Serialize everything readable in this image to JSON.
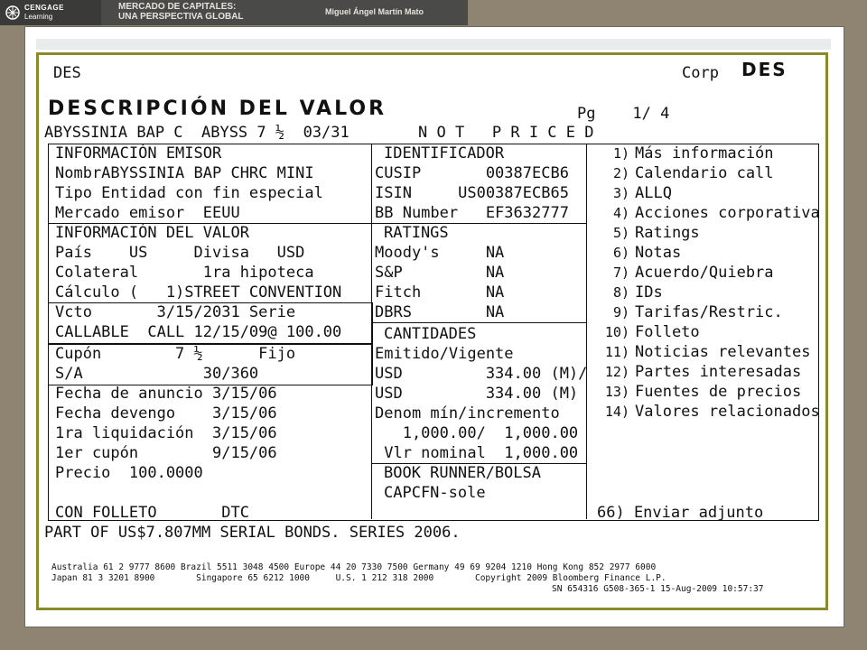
{
  "banner": {
    "logo_line1": "CENGAGE",
    "logo_line2": "Learning",
    "title_line1": "MERCADO DE CAPITALES:",
    "title_line2": "UNA PERSPECTIVA GLOBAL",
    "author": "Miguel Ángel Martín Mato"
  },
  "terminal": {
    "top_left": "DES",
    "top_right": "Corp",
    "top_logo": "DES",
    "heading": "DESCRIPCIÓN DEL VALOR",
    "page": "Pg    1/ 4",
    "security_line": "ABYSSINIA BAP C  ABYSS 7 ½  03/31",
    "status": "N O T   P R I C E D",
    "issuer": {
      "header": "INFORMACIÓN EMISOR",
      "rows": [
        "NombrABYSSINIA BAP CHRC MINI",
        "Tipo Entidad con fin especial",
        "Mercado emisor  EEUU"
      ]
    },
    "identifier": {
      "header": "IDENTIFICADOR",
      "rows": [
        "CUSIP       00387ECB6",
        "ISIN     US00387ECB65",
        "BB Number   EF3632777"
      ]
    },
    "security_info": {
      "header": "INFORMACIÓN DEL VALOR",
      "rows": [
        "País    US     Divisa   USD",
        "Colateral       1ra hipoteca",
        "Cálculo (   1)STREET CONVENTION"
      ]
    },
    "maturity": [
      "Vcto       3/15/2031 Serie",
      "CALLABLE  CALL 12/15/09@ 100.00"
    ],
    "coupon": [
      "Cupón        7 ½      Fijo",
      "S/A             30/360"
    ],
    "dates": [
      "Fecha de anuncio 3/15/06",
      "Fecha devengo    3/15/06",
      "1ra liquidación  3/15/06",
      "1er cupón        9/15/06",
      "Precio  100.0000"
    ],
    "prospectus": "CON FOLLETO       DTC",
    "ratings": {
      "header": "RATINGS",
      "rows": [
        "Moody's     NA",
        "S&P         NA",
        "Fitch       NA",
        "DBRS        NA"
      ]
    },
    "amounts": {
      "header": "CANTIDADES",
      "rows": [
        "Emitido/Vigente",
        "USD         334.00 (M)/",
        "USD         334.00 (M)",
        "Denom mín/incremento",
        "   1,000.00/  1,000.00",
        " Vlr nominal  1,000.00"
      ]
    },
    "bookrunner": {
      "header": "BOOK RUNNER/BOLSA",
      "value": "CAPCFN-sole"
    },
    "menu": [
      {
        "num": "1)",
        "label": "Más información"
      },
      {
        "num": "2)",
        "label": "Calendario call"
      },
      {
        "num": "3)",
        "label": "ALLQ"
      },
      {
        "num": "4)",
        "label": "Acciones corporativa"
      },
      {
        "num": "5)",
        "label": "Ratings"
      },
      {
        "num": "6)",
        "label": "Notas"
      },
      {
        "num": "7)",
        "label": "Acuerdo/Quiebra"
      },
      {
        "num": "8)",
        "label": "IDs"
      },
      {
        "num": "9)",
        "label": "Tarifas/Restric."
      },
      {
        "num": "10)",
        "label": "Folleto"
      },
      {
        "num": "11)",
        "label": "Noticias relevantes"
      },
      {
        "num": "12)",
        "label": "Partes interesadas"
      },
      {
        "num": "13)",
        "label": "Fuentes de precios"
      },
      {
        "num": "14)",
        "label": "Valores relacionados"
      }
    ],
    "send": "66) Enviar adjunto",
    "note": "PART OF US$7.807MM SERIAL BONDS. SERIES 2006.",
    "footer_line1": "Australia 61 2 9777 8600 Brazil 5511 3048 4500 Europe 44 20 7330 7500 Germany 49 69 9204 1210 Hong Kong 852 2977 6000",
    "footer_line2": "Japan 81 3 3201 8900        Singapore 65 6212 1000     U.S. 1 212 318 2000        Copyright 2009 Bloomberg Finance L.P.",
    "footer_line3": "SN 654316 G508-365-1 15-Aug-2009 10:57:37"
  }
}
